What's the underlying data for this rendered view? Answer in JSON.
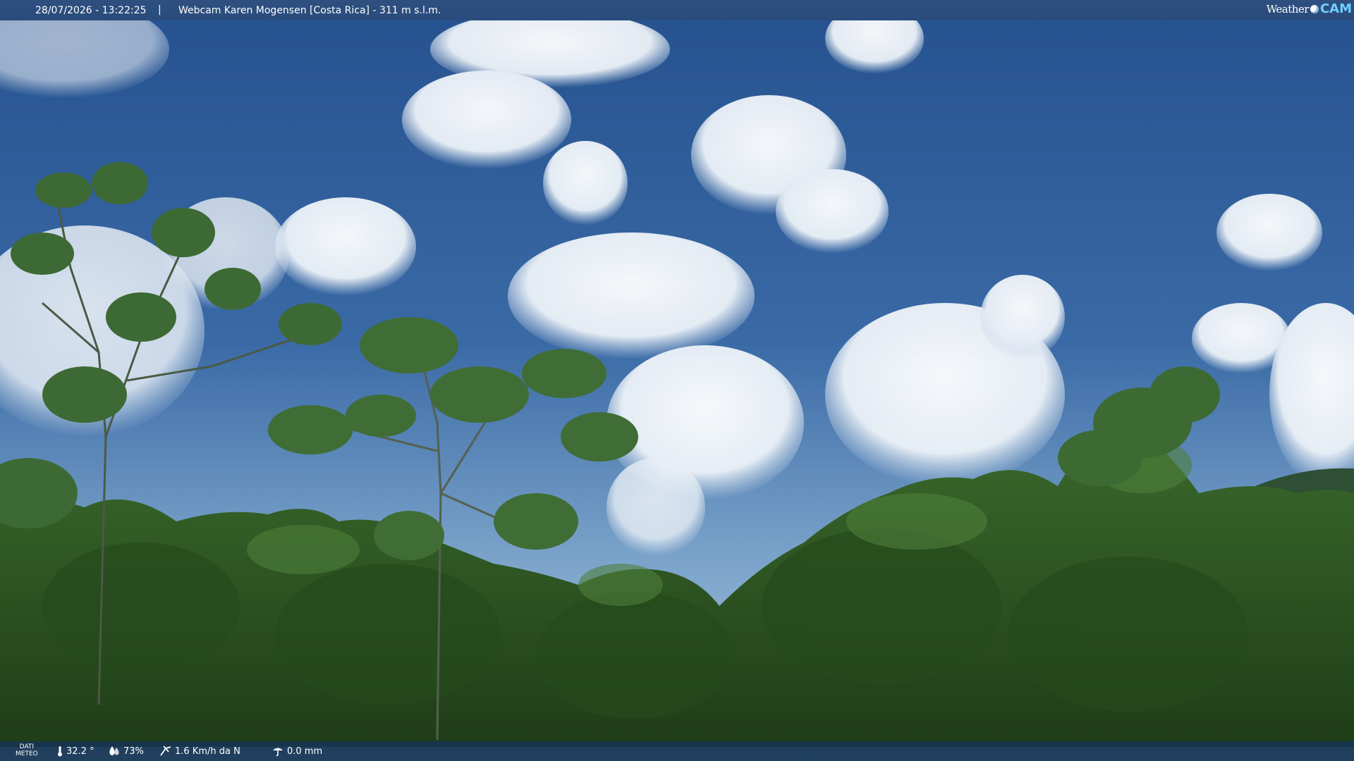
{
  "header": {
    "timestamp": "28/07/2026 - 13:22:25",
    "separator": "|",
    "title": "Webcam Karen Mogensen [Costa Rica] - 311 m s.l.m.",
    "logo_text_left": "Weather",
    "logo_text_right": "CAM"
  },
  "weather_bar": {
    "dati_label_1": "DATI",
    "dati_label_2": "METEO",
    "temperature": "32.2 °",
    "humidity": "73%",
    "wind": "1.6 Km/h da N",
    "rain": "0.0 mm",
    "icons": [
      "thermometer-icon",
      "humidity-drop-icon",
      "wind-icon",
      "rain-icon"
    ]
  },
  "colors": {
    "sky_top": "#2d5a96",
    "sky_horizon": "#8eb2d4",
    "foliage": "#2f5a24",
    "logo_accent": "#6fd0ff"
  }
}
